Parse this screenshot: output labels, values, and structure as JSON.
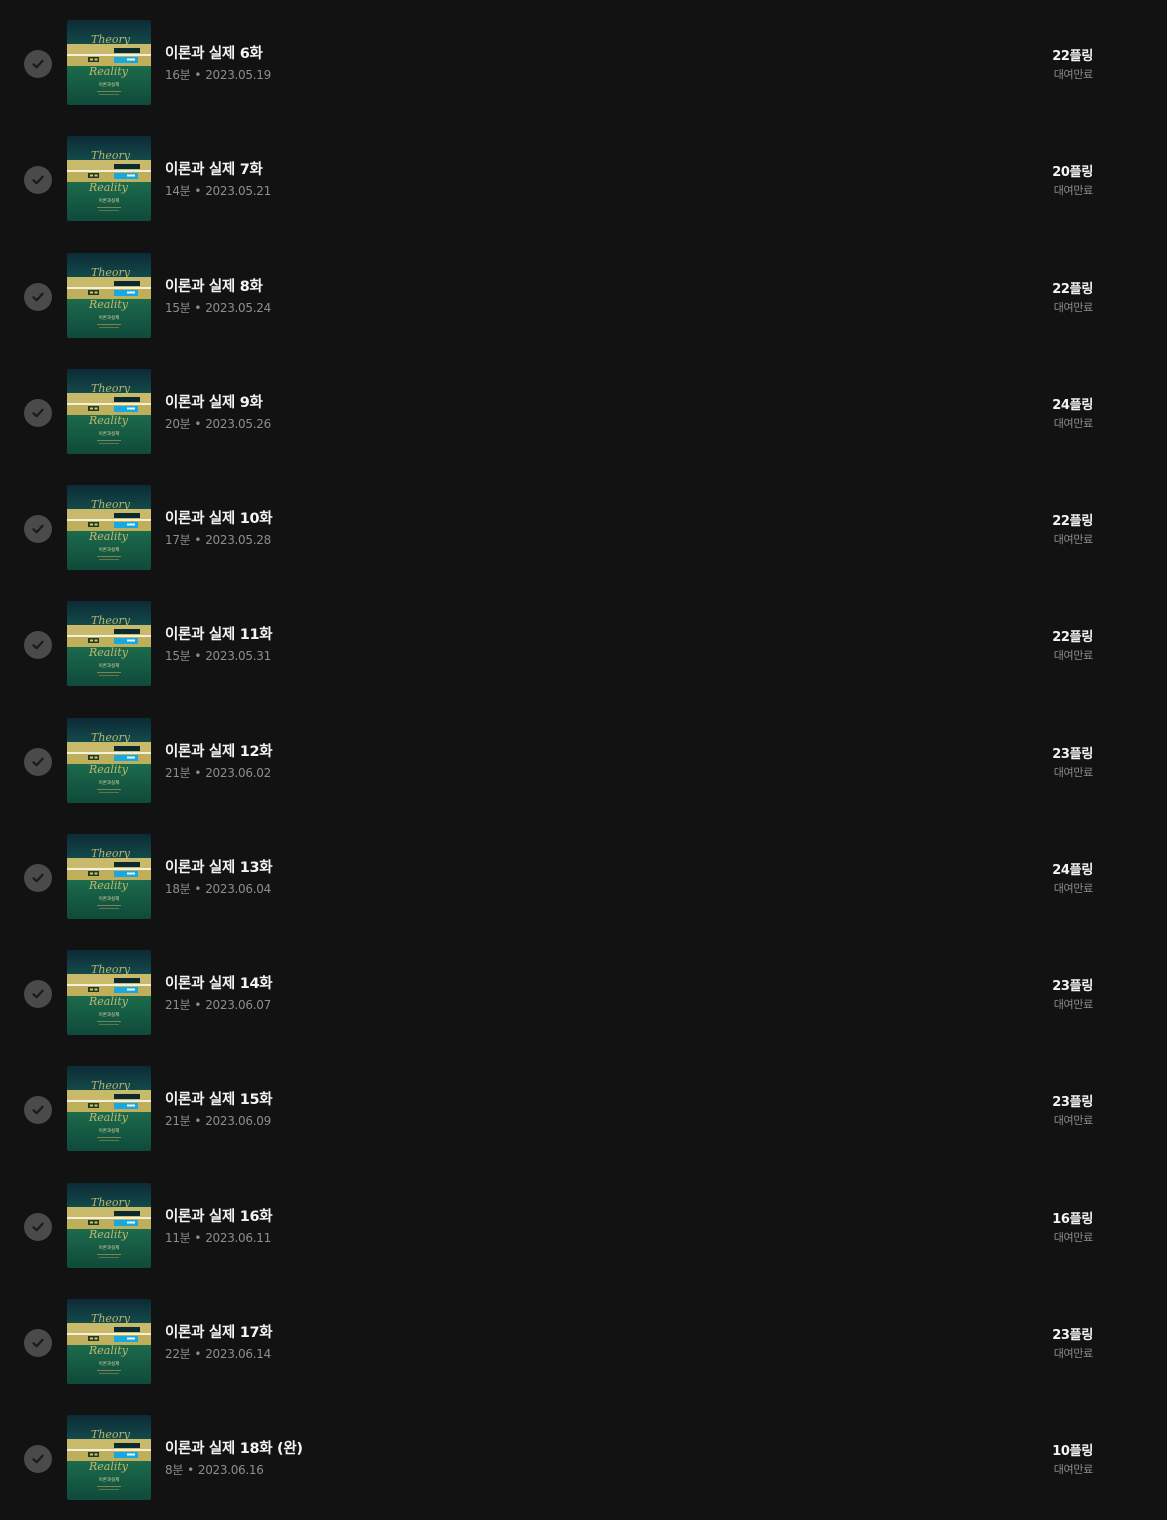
{
  "episodes": [
    {
      "title": "이론과 실제 6화",
      "duration": "16분",
      "date": "2023.05.19",
      "price": "22플링",
      "status": "대여만료"
    },
    {
      "title": "이론과 실제 7화",
      "duration": "14분",
      "date": "2023.05.21",
      "price": "20플링",
      "status": "대여만료"
    },
    {
      "title": "이론과 실제 8화",
      "duration": "15분",
      "date": "2023.05.24",
      "price": "22플링",
      "status": "대여만료"
    },
    {
      "title": "이론과 실제 9화",
      "duration": "20분",
      "date": "2023.05.26",
      "price": "24플링",
      "status": "대여만료"
    },
    {
      "title": "이론과 실제 10화",
      "duration": "17분",
      "date": "2023.05.28",
      "price": "22플링",
      "status": "대여만료"
    },
    {
      "title": "이론과 실제 11화",
      "duration": "15분",
      "date": "2023.05.31",
      "price": "22플링",
      "status": "대여만료"
    },
    {
      "title": "이론과 실제 12화",
      "duration": "21분",
      "date": "2023.06.02",
      "price": "23플링",
      "status": "대여만료"
    },
    {
      "title": "이론과 실제 13화",
      "duration": "18분",
      "date": "2023.06.04",
      "price": "24플링",
      "status": "대여만료"
    },
    {
      "title": "이론과 실제 14화",
      "duration": "21분",
      "date": "2023.06.07",
      "price": "23플링",
      "status": "대여만료"
    },
    {
      "title": "이론과 실제 15화",
      "duration": "21분",
      "date": "2023.06.09",
      "price": "23플링",
      "status": "대여만료"
    },
    {
      "title": "이론과 실제 16화",
      "duration": "11분",
      "date": "2023.06.11",
      "price": "16플링",
      "status": "대여만료"
    },
    {
      "title": "이론과 실제 17화",
      "duration": "22분",
      "date": "2023.06.14",
      "price": "23플링",
      "status": "대여만료"
    },
    {
      "title": "이론과 실제 18화 (완)",
      "duration": "8분",
      "date": "2023.06.16",
      "price": "10플링",
      "status": "대여만료"
    }
  ],
  "meta_separator": "•",
  "thumbnail": {
    "word_top": "Theory",
    "word_bottom": "Reality",
    "caption": "이론과실제"
  },
  "icons": {
    "played": "check-circle-icon"
  },
  "colors": {
    "background": "#121212",
    "check_circle": "#4a4a4a",
    "title": "#f4f4f4",
    "secondary": "#8d8d8d"
  }
}
